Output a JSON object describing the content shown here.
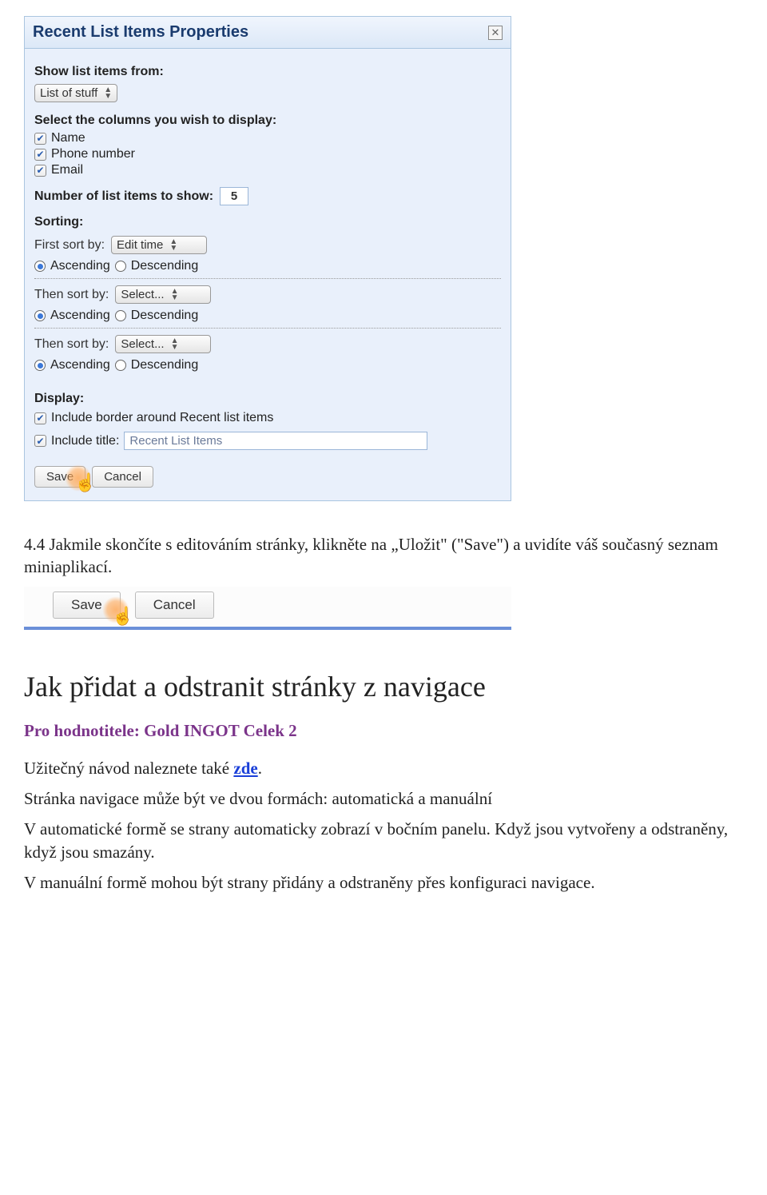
{
  "dialog": {
    "title": "Recent List Items Properties",
    "show_from_label": "Show list items from:",
    "show_from_value": "List of stuff",
    "columns_label": "Select the columns you wish to display:",
    "col_name": "Name",
    "col_phone": "Phone number",
    "col_email": "Email",
    "num_label": "Number of list items to show:",
    "num_value": "5",
    "sorting_label": "Sorting:",
    "first_sort_label": "First sort by:",
    "first_sort_value": "Edit time",
    "then_sort_label": "Then sort by:",
    "then_sort_value": "Select...",
    "ascending": "Ascending",
    "descending": "Descending",
    "display_label": "Display:",
    "include_border": "Include border around Recent list items",
    "include_title": "Include title:",
    "title_value": "Recent List Items",
    "save": "Save",
    "cancel": "Cancel"
  },
  "bar": {
    "save": "Save",
    "cancel": "Cancel"
  },
  "para1": "4.4 Jakmile skončíte s editováním stránky, klikněte na „Uložit\" (\"Save\") a uvidíte váš současný seznam miniaplikací.",
  "heading": "Jak přidat a odstranit stránky z navigace",
  "purple": "Pro hodnotitele: Gold INGOT Celek 2",
  "para2a": "Užitečný návod naleznete také ",
  "para2_link": "zde",
  "para2b": ".",
  "para3": "Stránka navigace může být ve dvou formách: automatická a manuální",
  "para4": "V automatické formě se strany automaticky zobrazí v bočním panelu. Když jsou vytvořeny a odstraněny, když jsou smazány.",
  "para5": "V manuální formě mohou být strany přidány a odstraněny přes konfiguraci navigace."
}
